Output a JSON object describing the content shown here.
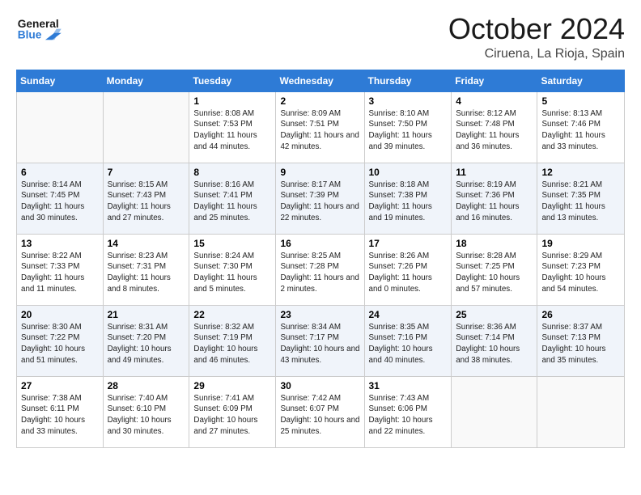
{
  "header": {
    "logo_line1": "General",
    "logo_line2": "Blue",
    "month": "October 2024",
    "location": "Ciruena, La Rioja, Spain"
  },
  "weekdays": [
    "Sunday",
    "Monday",
    "Tuesday",
    "Wednesday",
    "Thursday",
    "Friday",
    "Saturday"
  ],
  "weeks": [
    [
      {
        "day": "",
        "sunrise": "",
        "sunset": "",
        "daylight": ""
      },
      {
        "day": "",
        "sunrise": "",
        "sunset": "",
        "daylight": ""
      },
      {
        "day": "1",
        "sunrise": "Sunrise: 8:08 AM",
        "sunset": "Sunset: 7:53 PM",
        "daylight": "Daylight: 11 hours and 44 minutes."
      },
      {
        "day": "2",
        "sunrise": "Sunrise: 8:09 AM",
        "sunset": "Sunset: 7:51 PM",
        "daylight": "Daylight: 11 hours and 42 minutes."
      },
      {
        "day": "3",
        "sunrise": "Sunrise: 8:10 AM",
        "sunset": "Sunset: 7:50 PM",
        "daylight": "Daylight: 11 hours and 39 minutes."
      },
      {
        "day": "4",
        "sunrise": "Sunrise: 8:12 AM",
        "sunset": "Sunset: 7:48 PM",
        "daylight": "Daylight: 11 hours and 36 minutes."
      },
      {
        "day": "5",
        "sunrise": "Sunrise: 8:13 AM",
        "sunset": "Sunset: 7:46 PM",
        "daylight": "Daylight: 11 hours and 33 minutes."
      }
    ],
    [
      {
        "day": "6",
        "sunrise": "Sunrise: 8:14 AM",
        "sunset": "Sunset: 7:45 PM",
        "daylight": "Daylight: 11 hours and 30 minutes."
      },
      {
        "day": "7",
        "sunrise": "Sunrise: 8:15 AM",
        "sunset": "Sunset: 7:43 PM",
        "daylight": "Daylight: 11 hours and 27 minutes."
      },
      {
        "day": "8",
        "sunrise": "Sunrise: 8:16 AM",
        "sunset": "Sunset: 7:41 PM",
        "daylight": "Daylight: 11 hours and 25 minutes."
      },
      {
        "day": "9",
        "sunrise": "Sunrise: 8:17 AM",
        "sunset": "Sunset: 7:39 PM",
        "daylight": "Daylight: 11 hours and 22 minutes."
      },
      {
        "day": "10",
        "sunrise": "Sunrise: 8:18 AM",
        "sunset": "Sunset: 7:38 PM",
        "daylight": "Daylight: 11 hours and 19 minutes."
      },
      {
        "day": "11",
        "sunrise": "Sunrise: 8:19 AM",
        "sunset": "Sunset: 7:36 PM",
        "daylight": "Daylight: 11 hours and 16 minutes."
      },
      {
        "day": "12",
        "sunrise": "Sunrise: 8:21 AM",
        "sunset": "Sunset: 7:35 PM",
        "daylight": "Daylight: 11 hours and 13 minutes."
      }
    ],
    [
      {
        "day": "13",
        "sunrise": "Sunrise: 8:22 AM",
        "sunset": "Sunset: 7:33 PM",
        "daylight": "Daylight: 11 hours and 11 minutes."
      },
      {
        "day": "14",
        "sunrise": "Sunrise: 8:23 AM",
        "sunset": "Sunset: 7:31 PM",
        "daylight": "Daylight: 11 hours and 8 minutes."
      },
      {
        "day": "15",
        "sunrise": "Sunrise: 8:24 AM",
        "sunset": "Sunset: 7:30 PM",
        "daylight": "Daylight: 11 hours and 5 minutes."
      },
      {
        "day": "16",
        "sunrise": "Sunrise: 8:25 AM",
        "sunset": "Sunset: 7:28 PM",
        "daylight": "Daylight: 11 hours and 2 minutes."
      },
      {
        "day": "17",
        "sunrise": "Sunrise: 8:26 AM",
        "sunset": "Sunset: 7:26 PM",
        "daylight": "Daylight: 11 hours and 0 minutes."
      },
      {
        "day": "18",
        "sunrise": "Sunrise: 8:28 AM",
        "sunset": "Sunset: 7:25 PM",
        "daylight": "Daylight: 10 hours and 57 minutes."
      },
      {
        "day": "19",
        "sunrise": "Sunrise: 8:29 AM",
        "sunset": "Sunset: 7:23 PM",
        "daylight": "Daylight: 10 hours and 54 minutes."
      }
    ],
    [
      {
        "day": "20",
        "sunrise": "Sunrise: 8:30 AM",
        "sunset": "Sunset: 7:22 PM",
        "daylight": "Daylight: 10 hours and 51 minutes."
      },
      {
        "day": "21",
        "sunrise": "Sunrise: 8:31 AM",
        "sunset": "Sunset: 7:20 PM",
        "daylight": "Daylight: 10 hours and 49 minutes."
      },
      {
        "day": "22",
        "sunrise": "Sunrise: 8:32 AM",
        "sunset": "Sunset: 7:19 PM",
        "daylight": "Daylight: 10 hours and 46 minutes."
      },
      {
        "day": "23",
        "sunrise": "Sunrise: 8:34 AM",
        "sunset": "Sunset: 7:17 PM",
        "daylight": "Daylight: 10 hours and 43 minutes."
      },
      {
        "day": "24",
        "sunrise": "Sunrise: 8:35 AM",
        "sunset": "Sunset: 7:16 PM",
        "daylight": "Daylight: 10 hours and 40 minutes."
      },
      {
        "day": "25",
        "sunrise": "Sunrise: 8:36 AM",
        "sunset": "Sunset: 7:14 PM",
        "daylight": "Daylight: 10 hours and 38 minutes."
      },
      {
        "day": "26",
        "sunrise": "Sunrise: 8:37 AM",
        "sunset": "Sunset: 7:13 PM",
        "daylight": "Daylight: 10 hours and 35 minutes."
      }
    ],
    [
      {
        "day": "27",
        "sunrise": "Sunrise: 7:38 AM",
        "sunset": "Sunset: 6:11 PM",
        "daylight": "Daylight: 10 hours and 33 minutes."
      },
      {
        "day": "28",
        "sunrise": "Sunrise: 7:40 AM",
        "sunset": "Sunset: 6:10 PM",
        "daylight": "Daylight: 10 hours and 30 minutes."
      },
      {
        "day": "29",
        "sunrise": "Sunrise: 7:41 AM",
        "sunset": "Sunset: 6:09 PM",
        "daylight": "Daylight: 10 hours and 27 minutes."
      },
      {
        "day": "30",
        "sunrise": "Sunrise: 7:42 AM",
        "sunset": "Sunset: 6:07 PM",
        "daylight": "Daylight: 10 hours and 25 minutes."
      },
      {
        "day": "31",
        "sunrise": "Sunrise: 7:43 AM",
        "sunset": "Sunset: 6:06 PM",
        "daylight": "Daylight: 10 hours and 22 minutes."
      },
      {
        "day": "",
        "sunrise": "",
        "sunset": "",
        "daylight": ""
      },
      {
        "day": "",
        "sunrise": "",
        "sunset": "",
        "daylight": ""
      }
    ]
  ]
}
